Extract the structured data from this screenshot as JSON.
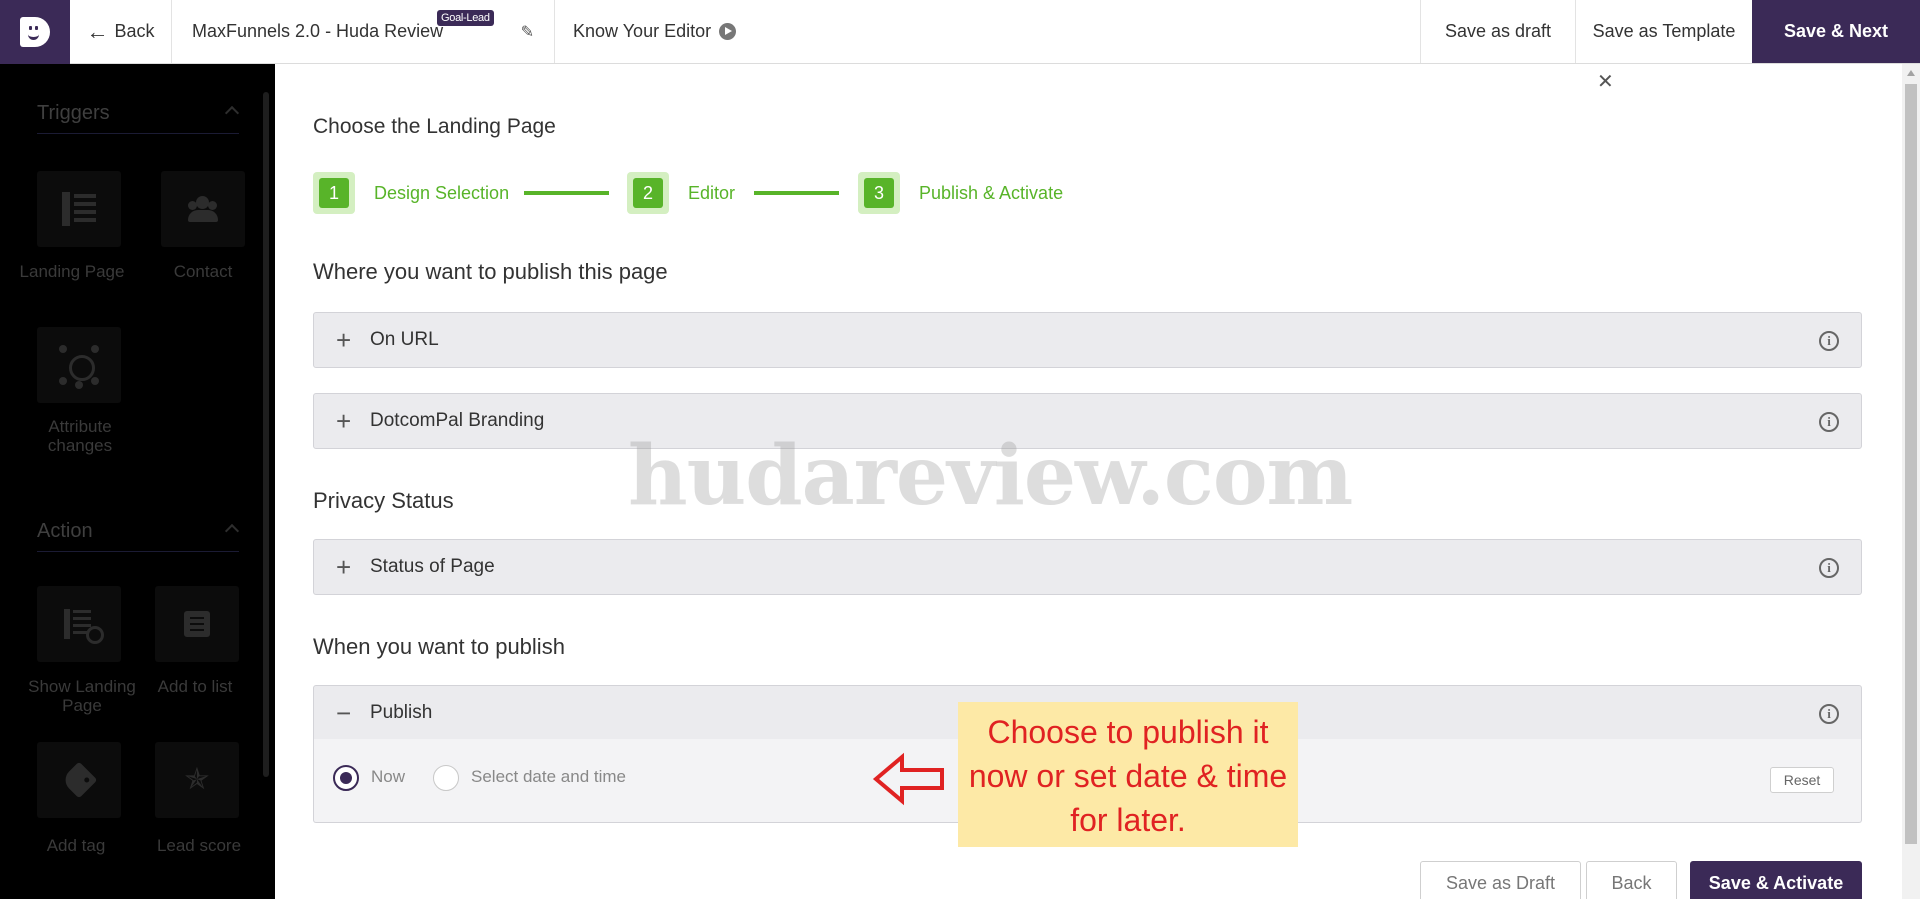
{
  "topbar": {
    "back_label": "Back",
    "title": "MaxFunnels 2.0 - Huda Review",
    "badge": "Goal-Lead",
    "editor_label": "Know Your Editor",
    "save_draft": "Save as draft",
    "save_template": "Save as Template",
    "save_next": "Save & Next"
  },
  "sidebar": {
    "triggers_title": "Triggers",
    "action_title": "Action",
    "triggers": [
      {
        "label": "Landing Page",
        "icon": "landing-page-icon"
      },
      {
        "label": "Contact",
        "icon": "contact-icon"
      },
      {
        "label": "Attribute changes",
        "icon": "attribute-changes-icon"
      }
    ],
    "actions": [
      {
        "label": "Show Landing Page",
        "icon": "show-landing-page-icon"
      },
      {
        "label": "Add to list",
        "icon": "add-to-list-icon"
      },
      {
        "label": "Add tag",
        "icon": "tag-icon"
      },
      {
        "label": "Lead score",
        "icon": "star-icon"
      }
    ]
  },
  "main": {
    "title": "Choose the Landing Page",
    "steps": [
      {
        "num": "1",
        "label": "Design Selection"
      },
      {
        "num": "2",
        "label": "Editor"
      },
      {
        "num": "3",
        "label": "Publish & Activate"
      }
    ],
    "publish_where_title": "Where you want to publish this page",
    "accordions": {
      "on_url": "On URL",
      "branding": "DotcomPal Branding",
      "status": "Status of Page",
      "publish": "Publish"
    },
    "privacy_title": "Privacy Status",
    "when_title": "When you want to publish",
    "radio_now": "Now",
    "radio_schedule": "Select date and time",
    "selected_option": "Now",
    "reset": "Reset",
    "buttons": {
      "save_draft": "Save as Draft",
      "back": "Back",
      "save_activate": "Save & Activate"
    }
  },
  "overlay": {
    "watermark": "hudareview.com",
    "callout": "Choose to publish it now or set date & time for later."
  },
  "colors": {
    "brand": "#3b2a57",
    "step_green": "#58b429",
    "callout_bg": "#fde9a6",
    "callout_text": "#e02222"
  }
}
